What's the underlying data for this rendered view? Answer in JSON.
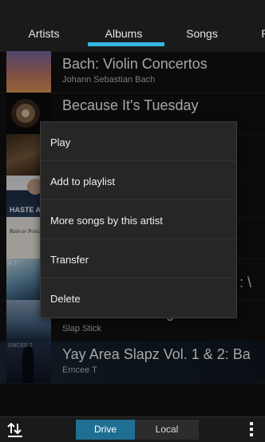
{
  "tabs": {
    "items": [
      "Artists",
      "Albums",
      "Songs",
      "P"
    ],
    "active": "Albums"
  },
  "albums": [
    {
      "title": "Bach: Violin Concertos",
      "artist": "Johann Sebastian Bach"
    },
    {
      "title": "Because It's Tuesday",
      "artist": ""
    },
    {
      "title": "",
      "artist": ""
    },
    {
      "title": "",
      "artist": ""
    },
    {
      "title": "",
      "artist": ""
    },
    {
      "title": "",
      "artist": ""
    },
    {
      "title": "Where we belong to...",
      "artist": "Slap Stick"
    },
    {
      "title": "Yay Area Slapz Vol. 1 & 2: Ba",
      "artist": "Emcee T"
    }
  ],
  "thumb_text": {
    "row4": "HASTE AS",
    "row5": "Rain or Poison",
    "row6_tag": "≡ 7",
    "row8_tag": "EMCEE T"
  },
  "menu": {
    "items": [
      "Play",
      "Add to playlist",
      "More songs by this artist",
      "Transfer",
      "Delete"
    ]
  },
  "bottom_bar": {
    "drive_label": "Drive",
    "local_label": "Local",
    "sort_icon": "sort-icon",
    "overflow_icon": "overflow-menu-icon"
  },
  "colors": {
    "accent": "#33b5e5",
    "drive_active": "#1f6f93"
  }
}
